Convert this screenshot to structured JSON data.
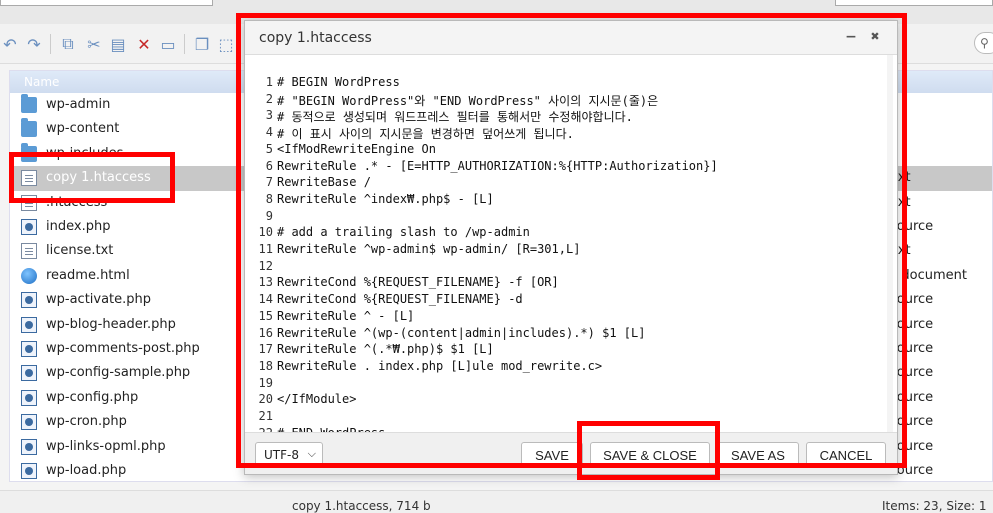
{
  "dialog": {
    "title": "copy 1.htaccess",
    "minimize_glyph": "−",
    "close_glyph": "✖",
    "encoding": "UTF-8",
    "buttons": {
      "save": "SAVE",
      "save_close": "SAVE & CLOSE",
      "save_as": "SAVE AS",
      "cancel": "CANCEL"
    },
    "lines": [
      {
        "n": "1",
        "text": "# BEGIN WordPress"
      },
      {
        "n": "2",
        "text": "# \"BEGIN WordPress\"와 \"END WordPress\" 사이의 지시문(줄)은"
      },
      {
        "n": "3",
        "text": "# 동적으로 생성되며 워드프레스 필터를 통해서만 수정해야합니다."
      },
      {
        "n": "4",
        "text": "# 이 표시 사이의 지시문을 변경하면 덮어쓰게 됩니다."
      },
      {
        "n": "5",
        "text": "<IfModRewriteEngine On"
      },
      {
        "n": "6",
        "text": "RewriteRule .* - [E=HTTP_AUTHORIZATION:%{HTTP:Authorization}]"
      },
      {
        "n": "7",
        "text": "RewriteBase /"
      },
      {
        "n": "8",
        "text": "RewriteRule ^index₩.php$ - [L]"
      },
      {
        "n": "9",
        "text": ""
      },
      {
        "n": "10",
        "text": "# add a trailing slash to /wp-admin"
      },
      {
        "n": "11",
        "text": "RewriteRule ^wp-admin$ wp-admin/ [R=301,L]"
      },
      {
        "n": "12",
        "text": ""
      },
      {
        "n": "13",
        "text": "RewriteCond %{REQUEST_FILENAME} -f [OR]"
      },
      {
        "n": "14",
        "text": "RewriteCond %{REQUEST_FILENAME} -d"
      },
      {
        "n": "15",
        "text": "RewriteRule ^ - [L]"
      },
      {
        "n": "16",
        "text": "RewriteRule ^(wp-(content|admin|includes).*) $1 [L]"
      },
      {
        "n": "17",
        "text": "RewriteRule ^(.*₩.php)$ $1 [L]"
      },
      {
        "n": "18",
        "text": "RewriteRule . index.php [L]ule mod_rewrite.c>"
      },
      {
        "n": "19",
        "text": ""
      },
      {
        "n": "20",
        "text": "</IfModule>"
      },
      {
        "n": "21",
        "text": ""
      },
      {
        "n": "22",
        "text": "# END WordPress"
      }
    ]
  },
  "file_list": {
    "header_name": "Name",
    "rows": [
      {
        "name": "wp-admin",
        "type": "",
        "icon": "folder-icon"
      },
      {
        "name": "wp-content",
        "type": "",
        "icon": "folder-icon"
      },
      {
        "name": "wp-includes",
        "type": "",
        "icon": "folder-icon"
      },
      {
        "name": "copy 1.htaccess",
        "type": "ext",
        "icon": "text-file-icon",
        "selected": true
      },
      {
        "name": ".htaccess",
        "type": "ext",
        "icon": "text-file-icon"
      },
      {
        "name": "index.php",
        "type": "source",
        "icon": "php-file-icon"
      },
      {
        "name": "license.txt",
        "type": "ext",
        "icon": "text-file-icon"
      },
      {
        "name": "readme.html",
        "type": "L document",
        "icon": "globe-icon"
      },
      {
        "name": "wp-activate.php",
        "type": "source",
        "icon": "php-file-icon"
      },
      {
        "name": "wp-blog-header.php",
        "type": "source",
        "icon": "php-file-icon"
      },
      {
        "name": "wp-comments-post.php",
        "type": "source",
        "icon": "php-file-icon"
      },
      {
        "name": "wp-config-sample.php",
        "type": "source",
        "icon": "php-file-icon"
      },
      {
        "name": "wp-config.php",
        "type": "source",
        "icon": "php-file-icon"
      },
      {
        "name": "wp-cron.php",
        "type": "source",
        "icon": "php-file-icon"
      },
      {
        "name": "wp-links-opml.php",
        "type": "source",
        "icon": "php-file-icon"
      },
      {
        "name": "wp-load.php",
        "type": "source",
        "icon": "php-file-icon"
      }
    ]
  },
  "status": {
    "left": "copy 1.htaccess, 714 b",
    "right": "Items: 23, Size: 1"
  },
  "colors": {
    "highlight": "#ff0000",
    "selected_row": "#c8c8c8"
  }
}
